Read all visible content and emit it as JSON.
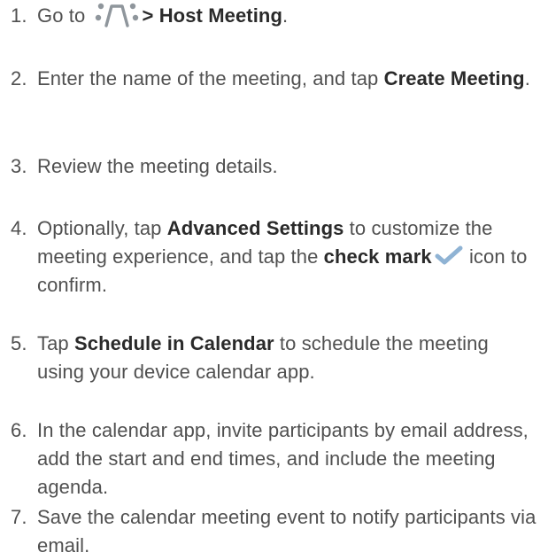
{
  "steps": [
    {
      "number": "1.",
      "before": "Go to ",
      "icon": "meeting-menu-icon",
      "bold": "> Host Meeting",
      "after": "."
    },
    {
      "number": "2.",
      "before": "Enter the name of the meeting, and tap ",
      "bold": "Create Meeting",
      "after": "."
    },
    {
      "number": "3.",
      "text": "Review the meeting details."
    },
    {
      "number": "4.",
      "before": "Optionally, tap ",
      "bold": "Advanced Settings",
      "middle": " to customize the meeting experience, and tap the ",
      "bold2": "check mark",
      "icon": "check-mark-icon",
      "after": " icon to confirm."
    },
    {
      "number": "5.",
      "before": "Tap ",
      "bold": "Schedule in Calendar",
      "after": " to schedule the meeting using your device calendar app."
    },
    {
      "number": "6.",
      "text": "In the calendar app, invite participants by email address, add the start and end times, and include the meeting agenda."
    },
    {
      "number": "7.",
      "text": "Save the calendar meeting event to notify participants via email."
    }
  ],
  "colors": {
    "text": "#505050",
    "bold_text": "#2a2a2a",
    "icon_gray": "#8f969c",
    "check_blue": "#8fb3d4"
  }
}
